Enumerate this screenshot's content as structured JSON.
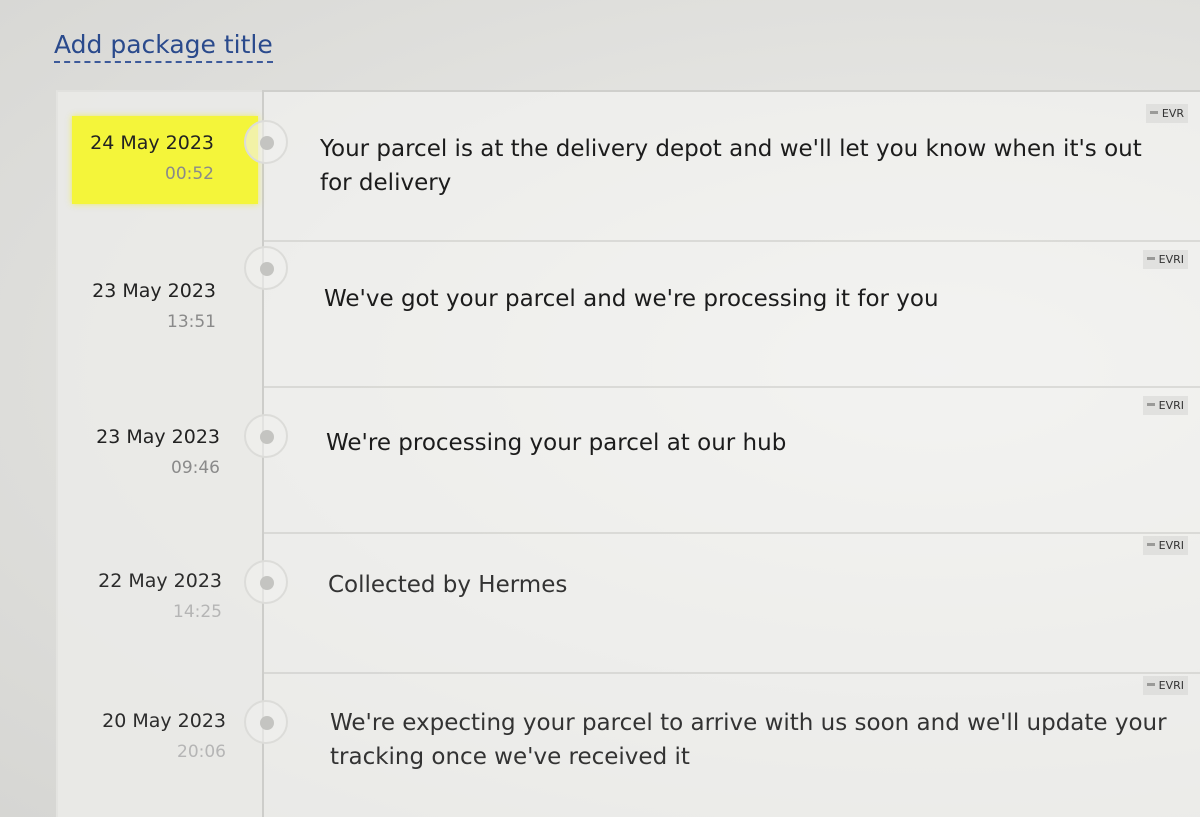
{
  "header": {
    "title_link": "Add package title"
  },
  "events": [
    {
      "date": "24 May 2023",
      "time": "00:52",
      "description": "Your parcel is at the delivery depot and we'll let you know when it's out for delivery",
      "carrier": "EVR",
      "highlighted": true
    },
    {
      "date": "23 May 2023",
      "time": "13:51",
      "description": "We've got your parcel and we're processing it for you",
      "carrier": "EVRI",
      "highlighted": false
    },
    {
      "date": "23 May 2023",
      "time": "09:46",
      "description": "We're processing your parcel at our hub",
      "carrier": "EVRI",
      "highlighted": false
    },
    {
      "date": "22 May 2023",
      "time": "14:25",
      "description": "Collected by Hermes",
      "carrier": "EVRI",
      "highlighted": false
    },
    {
      "date": "20 May 2023",
      "time": "20:06",
      "description": "We're expecting your parcel to arrive with us soon and we'll update your tracking once we've received it",
      "carrier": "EVRI",
      "highlighted": false
    }
  ],
  "colors": {
    "link": "#2a4a8c",
    "highlight": "#f4f53a",
    "timeline": "#cdcdca"
  },
  "icons": {
    "timeline_node": "circle-dot-icon",
    "carrier_logo": "carrier-logo-icon"
  }
}
